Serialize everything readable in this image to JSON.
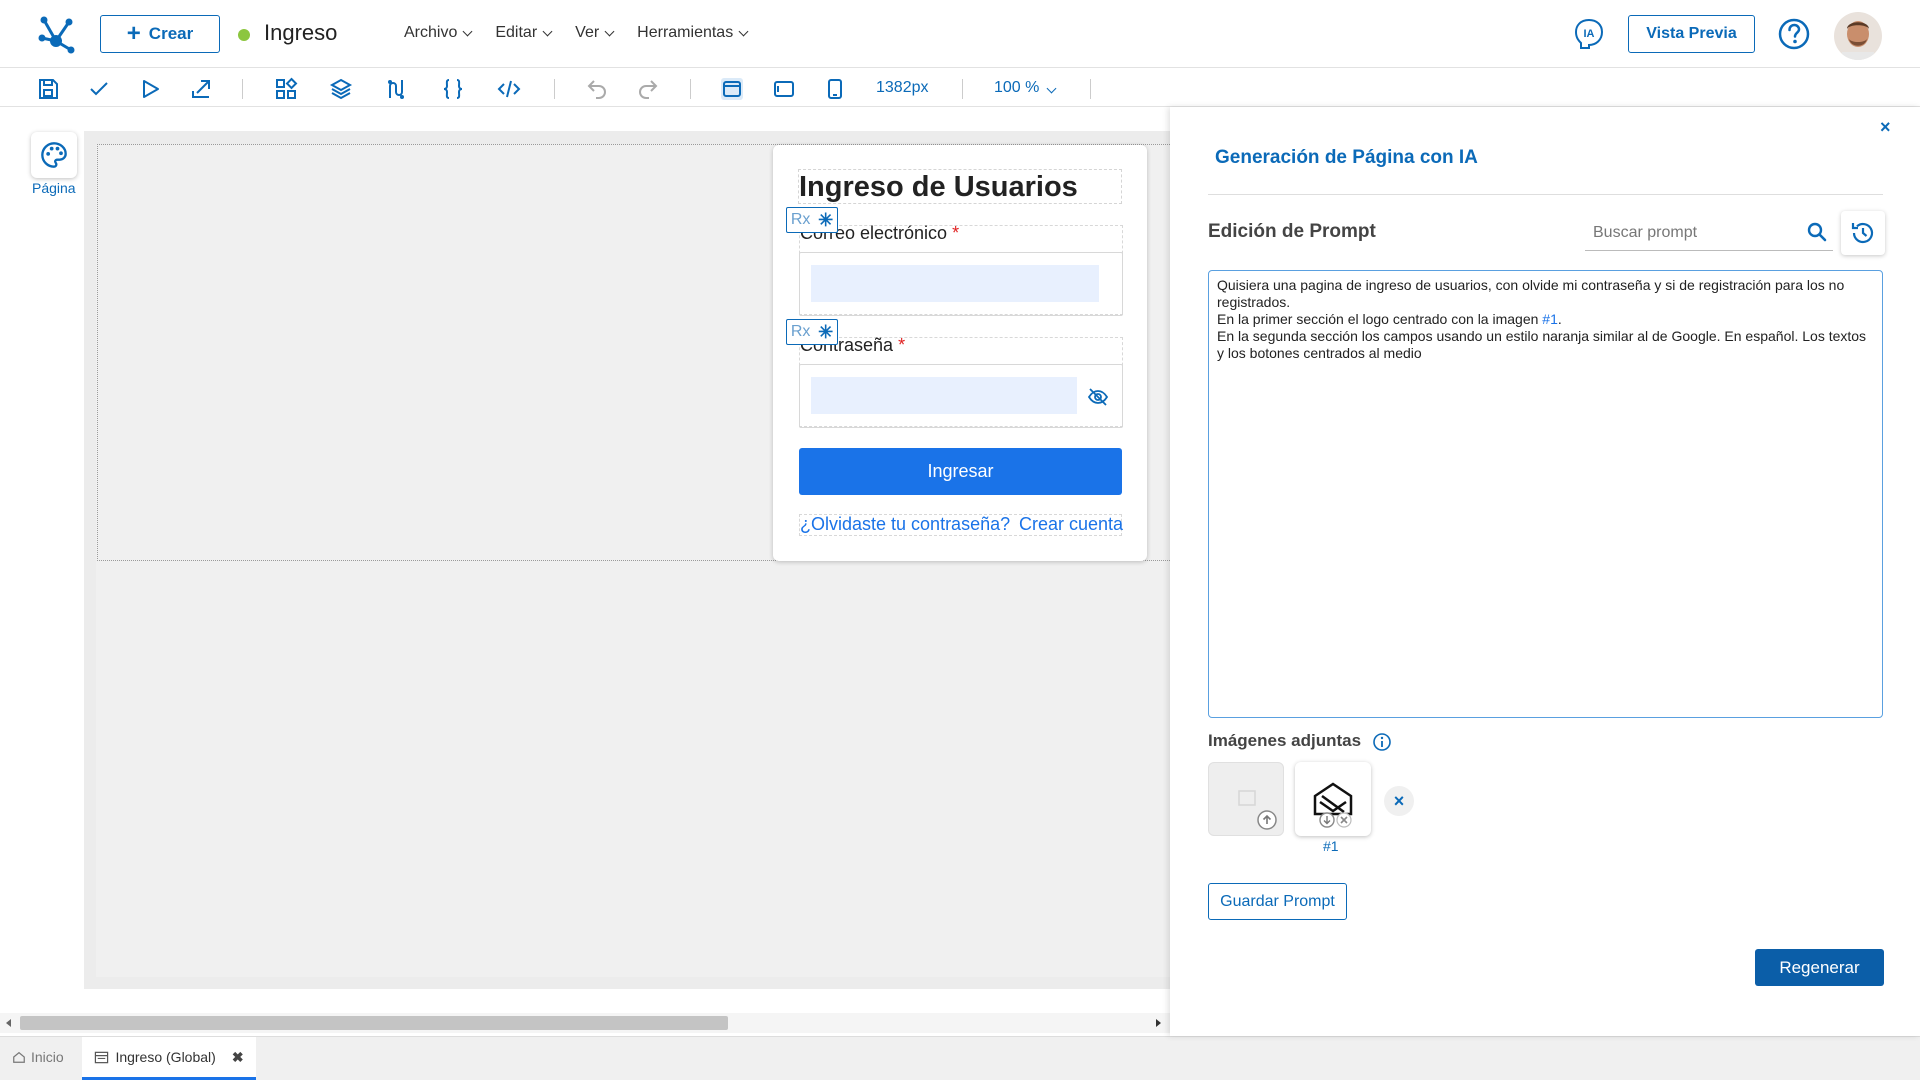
{
  "header": {
    "create_label": "Crear",
    "app_title": "Ingreso",
    "menu": [
      "Archivo",
      "Editar",
      "Ver",
      "Herramientas"
    ],
    "ia_label": "IA",
    "preview_label": "Vista Previa",
    "status_color": "#8cc63f",
    "accent_color": "#0b6ab8"
  },
  "toolbar": {
    "icons": [
      "save-icon",
      "check-icon",
      "play-icon",
      "export-icon",
      "widgets-icon",
      "layers-icon",
      "flow-icon",
      "braces-icon",
      "code-icon",
      "undo-icon",
      "redo-icon",
      "desktop-icon",
      "tablet-icon",
      "mobile-icon"
    ],
    "width_label": "1382px",
    "zoom_label": "100 %"
  },
  "rail": {
    "page_label": "Página"
  },
  "canvas": {
    "card_title": "Ingreso de Usuarios",
    "rx_label": "Rx",
    "email_label": "Correo electrónico",
    "password_label": "Contraseña",
    "required_mark": "*",
    "login_button": "Ingresar",
    "forgot_link": "¿Olvidaste tu contraseña?",
    "create_link": "Crear cuenta",
    "button_color": "#1a73e8"
  },
  "bottom_tabs": {
    "home": "Inicio",
    "active": "Ingreso (Global)"
  },
  "panel": {
    "close": "×",
    "title": "Generación de Página con IA",
    "prompt_section": "Edición de Prompt",
    "search_placeholder": "Buscar prompt",
    "prompt_line1": "Quisiera una pagina de ingreso de usuarios, con olvide mi contraseña y si de registración para los no registrados.",
    "prompt_line2_pre": "En la primer sección el logo centrado con la imagen ",
    "prompt_line2_ref": "#1",
    "prompt_line2_post": ".",
    "prompt_line3": "En la segunda sección los campos usando un estilo naranja similar al de Google. En español. Los textos y los botones centrados al medio",
    "images_title": "Imágenes adjuntas",
    "image_label": "#1",
    "delete_mark": "×",
    "save_prompt": "Guardar Prompt",
    "regenerate": "Regenerar"
  }
}
